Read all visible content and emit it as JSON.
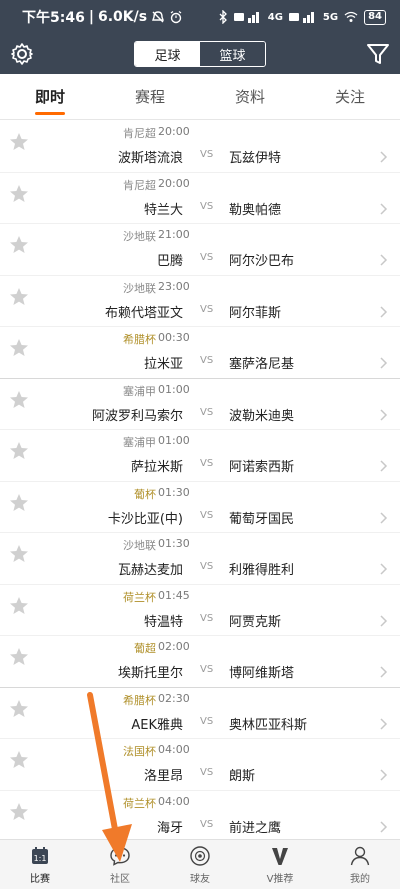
{
  "status_bar": {
    "time": "下午5:46",
    "speed": "6.0K/s",
    "signal_1": "4G",
    "signal_2": "5G",
    "battery": "84"
  },
  "header": {
    "sport_tabs": [
      {
        "label": "足球",
        "active": true
      },
      {
        "label": "篮球",
        "active": false
      }
    ]
  },
  "tabs": [
    {
      "label": "即时",
      "active": true
    },
    {
      "label": "赛程",
      "active": false
    },
    {
      "label": "资料",
      "active": false
    },
    {
      "label": "关注",
      "active": false
    }
  ],
  "matches": [
    {
      "league": "肯尼超",
      "time": "20:00",
      "home": "波斯塔流浪",
      "vs": "VS",
      "away": "瓦兹伊特",
      "league_color": "gray"
    },
    {
      "league": "肯尼超",
      "time": "20:00",
      "home": "特兰大",
      "vs": "VS",
      "away": "勒奥帕德",
      "league_color": "gray"
    },
    {
      "league": "沙地联",
      "time": "21:00",
      "home": "巴腾",
      "vs": "VS",
      "away": "阿尔沙巴布",
      "league_color": "gray"
    },
    {
      "league": "沙地联",
      "time": "23:00",
      "home": "布赖代塔亚文",
      "vs": "VS",
      "away": "阿尔菲斯",
      "league_color": "gray"
    },
    {
      "league": "希腊杯",
      "time": "00:30",
      "home": "拉米亚",
      "vs": "VS",
      "away": "塞萨洛尼基",
      "league_color": "gold"
    },
    {
      "league": "塞浦甲",
      "time": "01:00",
      "home": "阿波罗利马索尔",
      "vs": "VS",
      "away": "波勒米迪奥",
      "league_color": "gray"
    },
    {
      "league": "塞浦甲",
      "time": "01:00",
      "home": "萨拉米斯",
      "vs": "VS",
      "away": "阿诺索西斯",
      "league_color": "gray"
    },
    {
      "league": "葡杯",
      "time": "01:30",
      "home": "卡沙比亚(中)",
      "vs": "VS",
      "away": "葡萄牙国民",
      "league_color": "gold"
    },
    {
      "league": "沙地联",
      "time": "01:30",
      "home": "瓦赫达麦加",
      "vs": "VS",
      "away": "利雅得胜利",
      "league_color": "gray"
    },
    {
      "league": "荷兰杯",
      "time": "01:45",
      "home": "特温特",
      "vs": "VS",
      "away": "阿贾克斯",
      "league_color": "gold"
    },
    {
      "league": "葡超",
      "time": "02:00",
      "home": "埃斯托里尔",
      "vs": "VS",
      "away": "博阿维斯塔",
      "league_color": "gold"
    },
    {
      "league": "希腊杯",
      "time": "02:30",
      "home": "AEK雅典",
      "vs": "VS",
      "away": "奥林匹亚科斯",
      "league_color": "gold"
    },
    {
      "league": "法国杯",
      "time": "04:00",
      "home": "洛里昂",
      "vs": "VS",
      "away": "朗斯",
      "league_color": "gold"
    },
    {
      "league": "荷兰杯",
      "time": "04:00",
      "home": "海牙",
      "vs": "VS",
      "away": "前进之鹰",
      "league_color": "gold"
    }
  ],
  "bottom_nav": [
    {
      "label": "比赛",
      "icon": "calendar-icon",
      "active": true
    },
    {
      "label": "社区",
      "icon": "chat-bubble-icon",
      "active": false
    },
    {
      "label": "球友",
      "icon": "ball-icon",
      "active": false
    },
    {
      "label": "V推荐",
      "icon": "v-icon",
      "active": false
    },
    {
      "label": "我的",
      "icon": "person-icon",
      "active": false
    }
  ],
  "colors": {
    "header_bg": "#3c4654",
    "accent": "#ff6a00",
    "gold_league": "#b0902a",
    "annotation_arrow": "#f07a2a"
  }
}
